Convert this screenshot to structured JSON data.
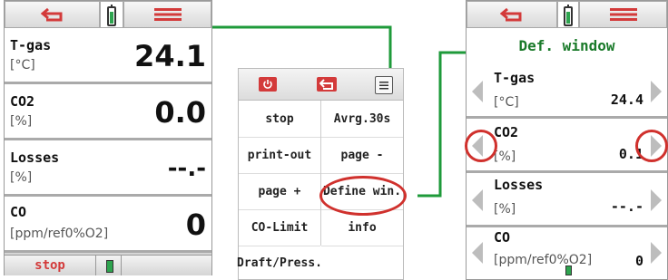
{
  "screen1": {
    "rows": [
      {
        "label": "T-gas",
        "unit": "[°C]",
        "value": "24.1"
      },
      {
        "label": "CO2",
        "unit": "[%]",
        "value": "0.0"
      },
      {
        "label": "Losses",
        "unit": "[%]",
        "value": "--.-"
      },
      {
        "label": "CO",
        "unit": "[ppm/ref0%O2]",
        "value": "0"
      }
    ],
    "bottom_button": "stop"
  },
  "menu": {
    "items": [
      [
        "stop",
        "Avrg.30s"
      ],
      [
        "print-out",
        "page -"
      ],
      [
        "page +",
        "Define win."
      ],
      [
        "CO-Limit",
        "info"
      ],
      [
        "Draft/Press.",
        ""
      ]
    ]
  },
  "screen2": {
    "title": "Def. window",
    "rows": [
      {
        "label": "T-gas",
        "unit": "[°C]",
        "value": "24.4"
      },
      {
        "label": "CO2",
        "unit": "[%]",
        "value": "0.1"
      },
      {
        "label": "Losses",
        "unit": "[%]",
        "value": "--.-"
      },
      {
        "label": "CO",
        "unit": "[ppm/ref0%O2]",
        "value": "0"
      }
    ]
  },
  "colors": {
    "accent_red": "#d33a3a",
    "connector_green": "#1e9a3a",
    "title_green": "#1a7a2a",
    "highlight_red": "#d0312d"
  },
  "icons": [
    "back-arrow-icon",
    "battery-icon",
    "menu-icon",
    "power-icon",
    "arrow-left-icon",
    "arrow-right-icon"
  ]
}
